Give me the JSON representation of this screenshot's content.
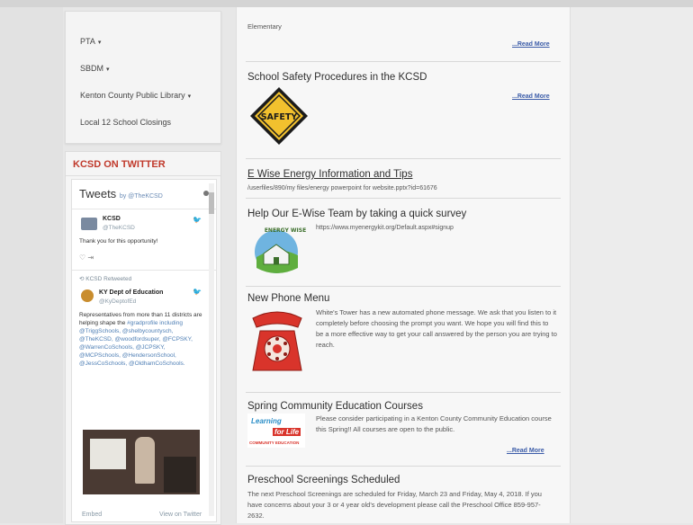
{
  "sidebar": {
    "menu": [
      {
        "label": "PTA",
        "caret": "▾"
      },
      {
        "label": "SBDM",
        "caret": "▾"
      },
      {
        "label": "Kenton County Public Library",
        "caret": "▾"
      },
      {
        "label": "Local 12 School Closings",
        "caret": ""
      }
    ],
    "twitter": {
      "heading": "KCSD ON TWITTER",
      "tweets_title": "Tweets",
      "tweets_by": "by @TheKCSD",
      "tweet1": {
        "name": "KCSD",
        "handle": "@TheKCSD",
        "text": "Thank you for this opportunity!",
        "actions": "♡   ⇥"
      },
      "retweet_label": "KCSD Retweeted",
      "tweet2": {
        "name": "KY Dept of Education",
        "handle": "@KyDeptofEd",
        "text": "Representatives from more than 11 districts are helping shape the",
        "links": "#gradprofile including @TriggSchools, @shelbycountysch, @TheKCSD, @woodfordsuper, @FCPSKY, @WarrenCoSchools, @JCPSKY, @MCPSchools, @HendersonSchool, @JessCoSchools, @OldhamCoSchools."
      },
      "embed": "Embed",
      "view_on_twitter": "View on Twitter"
    }
  },
  "main": {
    "top_fragment": "Elementary",
    "read_more": "...Read More",
    "articles": {
      "safety": {
        "title": "School Safety Procedures in the KCSD",
        "sign_text": "SAFETY"
      },
      "ewise_info": {
        "title": "E Wise Energy Information and Tips",
        "path": "/userfiles/890/my files/energy powerpoint for website.pptx?id=61676"
      },
      "ewise_survey": {
        "title": "Help Our E-Wise Team by taking a quick survey",
        "url": "https://www.myenergykit.org/Default.aspx#signup",
        "logo_text": "ENERGY WISE"
      },
      "phone": {
        "title": "New Phone Menu",
        "body": "White's Tower has a new automated phone message. We ask that you listen to it completely before choosing the prompt you want. We hope you will find this to be a more effective way to get your call answered by the person you are trying to reach."
      },
      "community": {
        "title": "Spring Community Education Courses",
        "body": "Please consider participating in a Kenton County Community Education course this Spring!! All courses are open to the public.",
        "logo_line1": "Learning",
        "logo_line2": "for Life",
        "logo_line3": "COMMUNITY EDUCATION"
      },
      "preschool": {
        "title": "Preschool Screenings Scheduled",
        "body": "The next Preschool Screenings are scheduled for Friday, March 23 and Friday, May 4, 2018. If you have concerns about your 3 or 4 year old's development please call the Preschool Office 859-957-2632."
      }
    }
  },
  "colors": {
    "twitter_heading": "#c0392b",
    "read_more": "#3a5ba8",
    "safety_yellow": "#f2c12e",
    "phone_red": "#d9342b"
  }
}
